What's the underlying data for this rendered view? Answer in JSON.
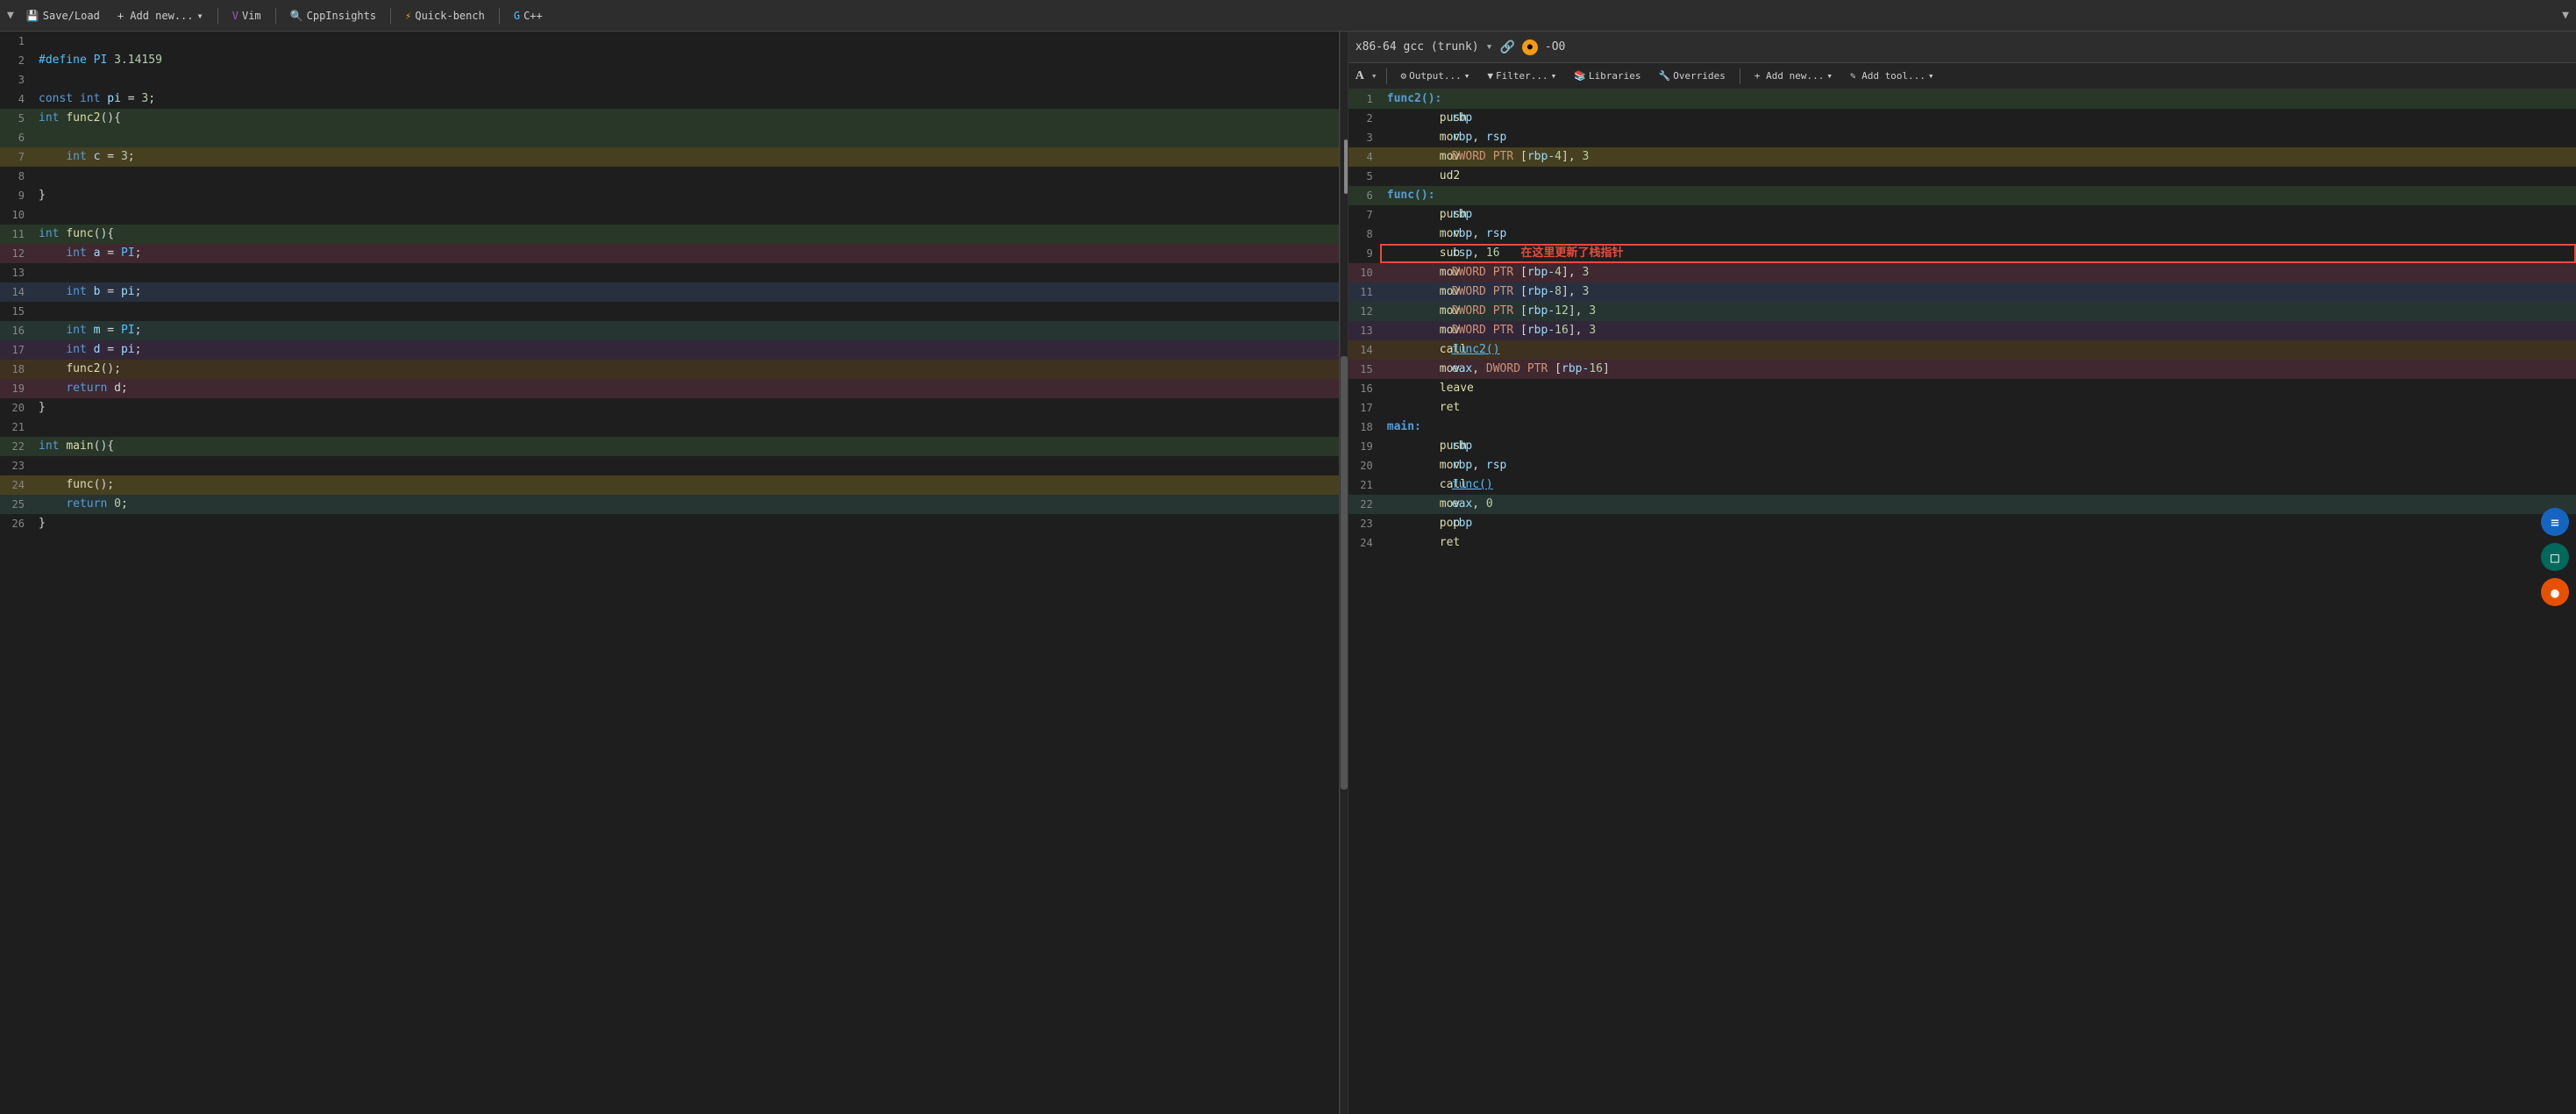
{
  "toolbar": {
    "save_load": "Save/Load",
    "add_new": "+ Add new...",
    "vim": "Vim",
    "cpp_insights": "CppInsights",
    "quick_bench": "Quick-bench",
    "cpp": "C++",
    "dropdown_arrow": "▼"
  },
  "asm_toolbar": {
    "compiler": "x86-64 gcc (trunk)",
    "opt": "-O0",
    "output": "Output...",
    "filter": "Filter...",
    "libraries": "Libraries",
    "overrides": "Overrides",
    "add_new": "+ Add new...",
    "add_tool": "✎ Add tool..."
  },
  "code_lines": [
    {
      "num": "1",
      "text": "",
      "bg": ""
    },
    {
      "num": "2",
      "text": "#define PI 3.14159",
      "bg": ""
    },
    {
      "num": "3",
      "text": "",
      "bg": ""
    },
    {
      "num": "4",
      "text": "const int pi = 3;",
      "bg": ""
    },
    {
      "num": "5",
      "text": "int func2(){",
      "bg": "green"
    },
    {
      "num": "6",
      "text": "",
      "bg": "green"
    },
    {
      "num": "7",
      "text": "    int c = 3;",
      "bg": "yellow"
    },
    {
      "num": "8",
      "text": "",
      "bg": ""
    },
    {
      "num": "9",
      "text": "}",
      "bg": ""
    },
    {
      "num": "10",
      "text": "",
      "bg": ""
    },
    {
      "num": "11",
      "text": "int func(){",
      "bg": "green"
    },
    {
      "num": "12",
      "text": "    int a = PI;",
      "bg": "pink"
    },
    {
      "num": "13",
      "text": "",
      "bg": ""
    },
    {
      "num": "14",
      "text": "    int b = pi;",
      "bg": "blue"
    },
    {
      "num": "15",
      "text": "",
      "bg": ""
    },
    {
      "num": "16",
      "text": "    int m = PI;",
      "bg": "teal"
    },
    {
      "num": "17",
      "text": "    int d = pi;",
      "bg": "purple"
    },
    {
      "num": "18",
      "text": "    func2();",
      "bg": "orange"
    },
    {
      "num": "19",
      "text": "    return d;",
      "bg": "pink"
    },
    {
      "num": "20",
      "text": "}",
      "bg": ""
    },
    {
      "num": "21",
      "text": "",
      "bg": ""
    },
    {
      "num": "22",
      "text": "int main(){",
      "bg": "green"
    },
    {
      "num": "23",
      "text": "",
      "bg": ""
    },
    {
      "num": "24",
      "text": "    func();",
      "bg": "yellow"
    },
    {
      "num": "25",
      "text": "    return 0;",
      "bg": "teal"
    },
    {
      "num": "26",
      "text": "}",
      "bg": ""
    }
  ],
  "asm_lines": [
    {
      "num": "1",
      "label": "func2():",
      "instr": "",
      "args": "",
      "bg": "green"
    },
    {
      "num": "2",
      "label": "",
      "instr": "push",
      "args": "rbp",
      "bg": ""
    },
    {
      "num": "3",
      "label": "",
      "instr": "mov",
      "args": "rbp, rsp",
      "bg": ""
    },
    {
      "num": "4",
      "label": "",
      "instr": "mov",
      "args": "DWORD PTR [rbp-4], 3",
      "bg": "yellow"
    },
    {
      "num": "5",
      "label": "",
      "instr": "ud2",
      "args": "",
      "bg": ""
    },
    {
      "num": "6",
      "label": "func():",
      "instr": "",
      "args": "",
      "bg": "green"
    },
    {
      "num": "7",
      "label": "",
      "instr": "push",
      "args": "rbp",
      "bg": ""
    },
    {
      "num": "8",
      "label": "",
      "instr": "mov",
      "args": "rbp, rsp",
      "bg": ""
    },
    {
      "num": "9",
      "label": "",
      "instr": "sub",
      "args": "rsp, 16",
      "bg": "",
      "selected": true,
      "comment": "在这里更新了栈指针"
    },
    {
      "num": "10",
      "label": "",
      "instr": "mov",
      "args": "DWORD PTR [rbp-4], 3",
      "bg": "pink"
    },
    {
      "num": "11",
      "label": "",
      "instr": "mov",
      "args": "DWORD PTR [rbp-8], 3",
      "bg": "blue"
    },
    {
      "num": "12",
      "label": "",
      "instr": "mov",
      "args": "DWORD PTR [rbp-12], 3",
      "bg": "teal"
    },
    {
      "num": "13",
      "label": "",
      "instr": "mov",
      "args": "DWORD PTR [rbp-16], 3",
      "bg": "purple"
    },
    {
      "num": "14",
      "label": "",
      "instr": "call",
      "args": "func2()",
      "bg": "orange",
      "link": true
    },
    {
      "num": "15",
      "label": "",
      "instr": "mov",
      "args": "eax, DWORD PTR [rbp-16]",
      "bg": "pink"
    },
    {
      "num": "16",
      "label": "",
      "instr": "leave",
      "args": "",
      "bg": ""
    },
    {
      "num": "17",
      "label": "",
      "instr": "ret",
      "args": "",
      "bg": ""
    },
    {
      "num": "18",
      "label": "main:",
      "instr": "",
      "args": "",
      "bg": ""
    },
    {
      "num": "19",
      "label": "",
      "instr": "push",
      "args": "rbp",
      "bg": ""
    },
    {
      "num": "20",
      "label": "",
      "instr": "mov",
      "args": "rbp, rsp",
      "bg": ""
    },
    {
      "num": "21",
      "label": "",
      "instr": "call",
      "args": "func()",
      "bg": "",
      "link": true
    },
    {
      "num": "22",
      "label": "",
      "instr": "mov",
      "args": "eax, 0",
      "bg": "teal"
    },
    {
      "num": "23",
      "label": "",
      "instr": "pop",
      "args": "rbp",
      "bg": ""
    },
    {
      "num": "24",
      "label": "",
      "instr": "ret",
      "args": "",
      "bg": ""
    }
  ]
}
